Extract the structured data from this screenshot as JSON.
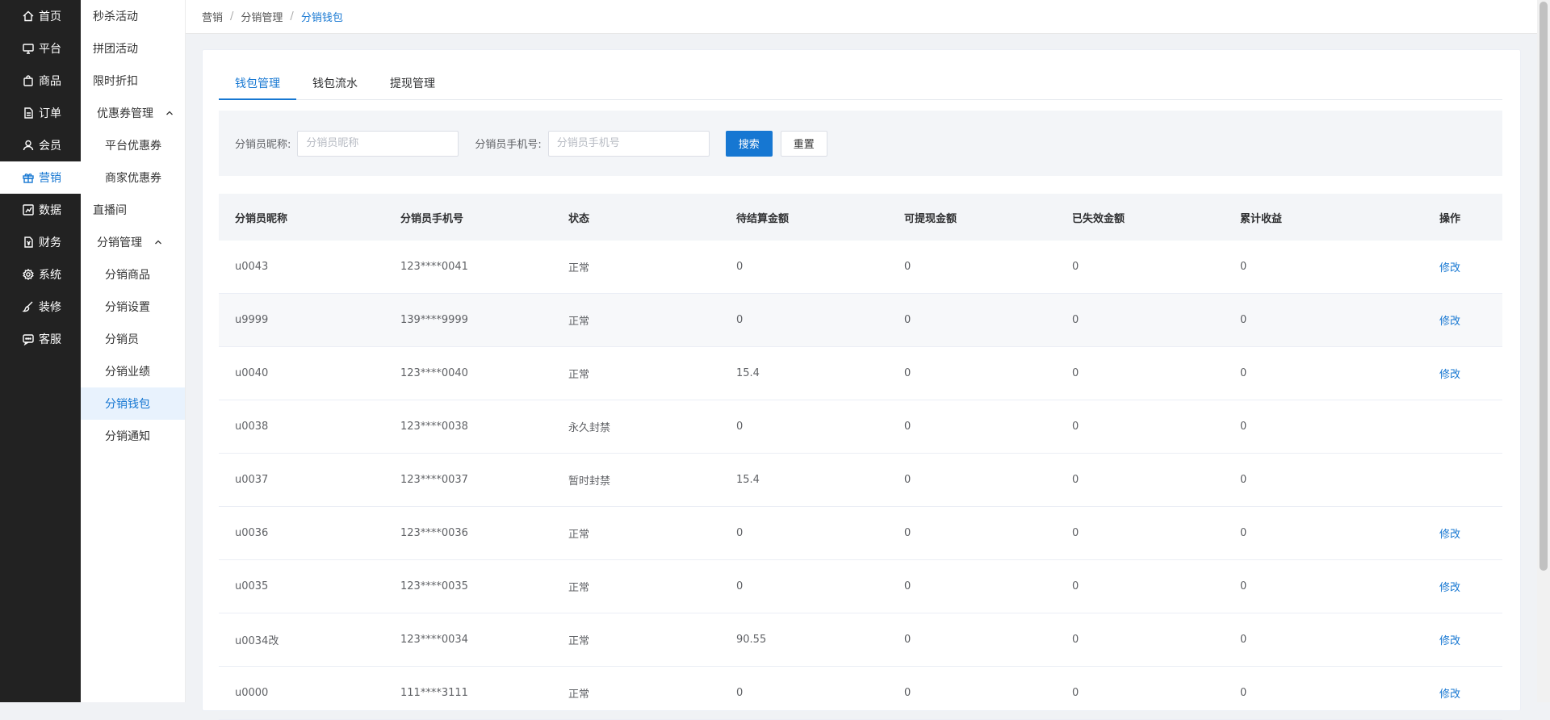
{
  "primary_nav": [
    {
      "label": "首页",
      "icon": "home-icon"
    },
    {
      "label": "平台",
      "icon": "monitor-icon"
    },
    {
      "label": "商品",
      "icon": "bag-icon"
    },
    {
      "label": "订单",
      "icon": "document-icon"
    },
    {
      "label": "会员",
      "icon": "user-icon"
    },
    {
      "label": "营销",
      "icon": "gift-icon",
      "active": true
    },
    {
      "label": "数据",
      "icon": "chart-icon"
    },
    {
      "label": "财务",
      "icon": "wallet-icon"
    },
    {
      "label": "系统",
      "icon": "gear-icon"
    },
    {
      "label": "装修",
      "icon": "brush-icon"
    },
    {
      "label": "客服",
      "icon": "chat-icon"
    }
  ],
  "secondary_nav": [
    {
      "label": "秒杀活动",
      "type": "item"
    },
    {
      "label": "拼团活动",
      "type": "item"
    },
    {
      "label": "限时折扣",
      "type": "item"
    },
    {
      "label": "优惠券管理",
      "type": "group"
    },
    {
      "label": "平台优惠券",
      "type": "sub"
    },
    {
      "label": "商家优惠券",
      "type": "sub"
    },
    {
      "label": "直播间",
      "type": "item"
    },
    {
      "label": "分销管理",
      "type": "group"
    },
    {
      "label": "分销商品",
      "type": "sub"
    },
    {
      "label": "分销设置",
      "type": "sub"
    },
    {
      "label": "分销员",
      "type": "sub"
    },
    {
      "label": "分销业绩",
      "type": "sub"
    },
    {
      "label": "分销钱包",
      "type": "sub",
      "active": true
    },
    {
      "label": "分销通知",
      "type": "sub"
    }
  ],
  "breadcrumb": [
    "营销",
    "分销管理",
    "分销钱包"
  ],
  "tabs": [
    "钱包管理",
    "钱包流水",
    "提现管理"
  ],
  "search": {
    "nickname_label": "分销员昵称:",
    "nickname_placeholder": "分销员昵称",
    "phone_label": "分销员手机号:",
    "phone_placeholder": "分销员手机号",
    "search_button": "搜索",
    "reset_button": "重置"
  },
  "table": {
    "columns": [
      "分销员昵称",
      "分销员手机号",
      "状态",
      "待结算金额",
      "可提现金额",
      "已失效金额",
      "累计收益",
      "操作"
    ],
    "rows": [
      {
        "nickname": "u0043",
        "phone": "123****0041",
        "status": "正常",
        "pending": "0",
        "withdrawable": "0",
        "expired": "0",
        "total": "0",
        "action": "修改"
      },
      {
        "nickname": "u9999",
        "phone": "139****9999",
        "status": "正常",
        "pending": "0",
        "withdrawable": "0",
        "expired": "0",
        "total": "0",
        "action": "修改"
      },
      {
        "nickname": "u0040",
        "phone": "123****0040",
        "status": "正常",
        "pending": "15.4",
        "withdrawable": "0",
        "expired": "0",
        "total": "0",
        "action": "修改"
      },
      {
        "nickname": "u0038",
        "phone": "123****0038",
        "status": "永久封禁",
        "pending": "0",
        "withdrawable": "0",
        "expired": "0",
        "total": "0",
        "action": ""
      },
      {
        "nickname": "u0037",
        "phone": "123****0037",
        "status": "暂时封禁",
        "pending": "15.4",
        "withdrawable": "0",
        "expired": "0",
        "total": "0",
        "action": ""
      },
      {
        "nickname": "u0036",
        "phone": "123****0036",
        "status": "正常",
        "pending": "0",
        "withdrawable": "0",
        "expired": "0",
        "total": "0",
        "action": "修改"
      },
      {
        "nickname": "u0035",
        "phone": "123****0035",
        "status": "正常",
        "pending": "0",
        "withdrawable": "0",
        "expired": "0",
        "total": "0",
        "action": "修改"
      },
      {
        "nickname": "u0034改",
        "phone": "123****0034",
        "status": "正常",
        "pending": "90.55",
        "withdrawable": "0",
        "expired": "0",
        "total": "0",
        "action": "修改"
      },
      {
        "nickname": "u0000",
        "phone": "111****3111",
        "status": "正常",
        "pending": "0",
        "withdrawable": "0",
        "expired": "0",
        "total": "0",
        "action": "修改"
      }
    ]
  },
  "colors": {
    "accent": "#1677d2",
    "sidebar_bg": "#222222"
  }
}
